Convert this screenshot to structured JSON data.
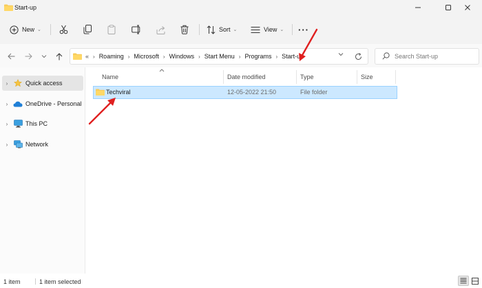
{
  "window": {
    "title": "Start-up",
    "minimize_glyph": "—",
    "maximize_glyph": "☐",
    "close_glyph": "✕"
  },
  "toolbar": {
    "new_label": "New",
    "sort_label": "Sort",
    "view_label": "View",
    "more_label": "···",
    "icons": [
      "cut-icon",
      "copy-icon",
      "paste-icon",
      "rename-icon",
      "share-icon",
      "delete-icon"
    ]
  },
  "address": {
    "overflow": "«",
    "crumbs": [
      "Roaming",
      "Microsoft",
      "Windows",
      "Start Menu",
      "Programs",
      "Start-up"
    ]
  },
  "search": {
    "placeholder": "Search Start-up"
  },
  "sidebar": {
    "items": [
      {
        "label": "Quick access",
        "icon": "star-icon",
        "selected": true
      },
      {
        "label": "OneDrive - Personal",
        "icon": "cloud-icon",
        "selected": false
      },
      {
        "label": "This PC",
        "icon": "pc-icon",
        "selected": false
      },
      {
        "label": "Network",
        "icon": "network-icon",
        "selected": false
      }
    ]
  },
  "columns": {
    "name": "Name",
    "date": "Date modified",
    "type": "Type",
    "size": "Size"
  },
  "files": [
    {
      "name": "Techviral",
      "date": "12-05-2022 21:50",
      "type": "File folder",
      "size": "",
      "selected": true
    }
  ],
  "status": {
    "count": "1 item",
    "selected": "1 item selected"
  },
  "colors": {
    "accent": "#0067c0",
    "selection_bg": "#cce8ff",
    "selection_border": "#99d1ff",
    "folder": "#f8cc5a",
    "annotation_arrow": "#e02020"
  }
}
